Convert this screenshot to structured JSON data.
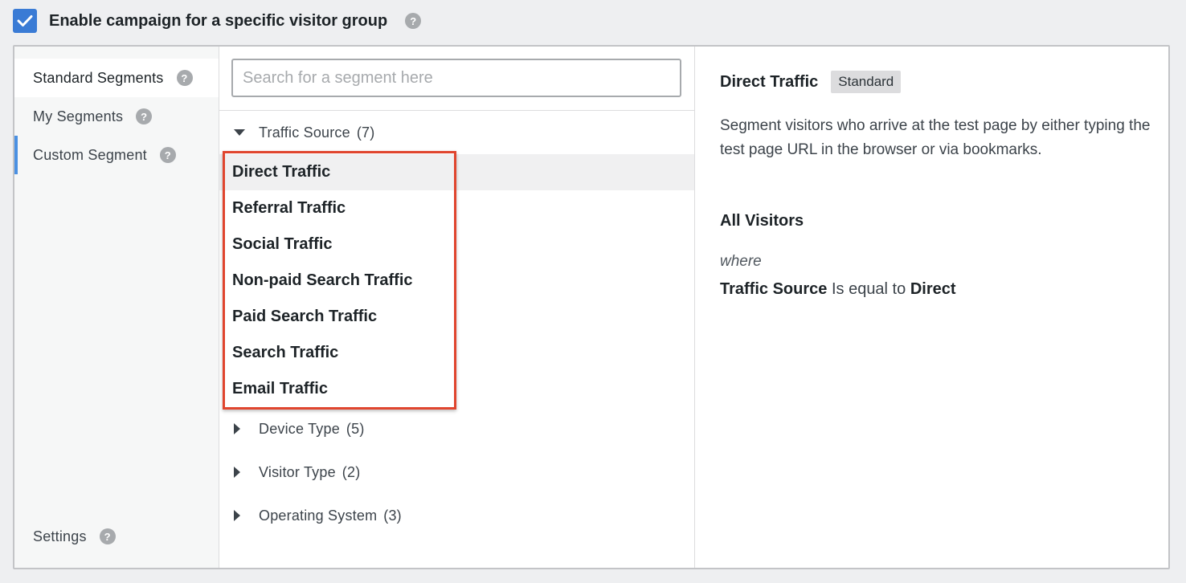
{
  "enable": {
    "label": "Enable campaign for a specific visitor group",
    "checked": true,
    "help_icon": "question-icon"
  },
  "sidebar": {
    "items": [
      {
        "label": "Standard Segments",
        "active": true
      },
      {
        "label": "My Segments",
        "active": false
      },
      {
        "label": "Custom Segment",
        "active": false
      }
    ],
    "settings_label": "Settings"
  },
  "search": {
    "placeholder": "Search for a segment here",
    "value": ""
  },
  "groups": [
    {
      "name": "Traffic Source",
      "count": "(7)",
      "expanded": true
    },
    {
      "name": "Device Type",
      "count": "(5)",
      "expanded": false
    },
    {
      "name": "Visitor Type",
      "count": "(2)",
      "expanded": false
    },
    {
      "name": "Operating System",
      "count": "(3)",
      "expanded": false
    }
  ],
  "segments": [
    "Direct Traffic",
    "Referral Traffic",
    "Social Traffic",
    "Non-paid Search Traffic",
    "Paid Search Traffic",
    "Search Traffic",
    "Email Traffic"
  ],
  "selected_segment": "Direct Traffic",
  "detail": {
    "title": "Direct Traffic",
    "badge": "Standard",
    "description": "Segment visitors who arrive at the test page by either typing the test page URL in the browser or via bookmarks.",
    "audience": "All Visitors",
    "where": "where",
    "rule": {
      "field": "Traffic Source",
      "operator": "Is equal to",
      "value": "Direct"
    }
  },
  "colors": {
    "accent": "#3a7bd5",
    "highlight_border": "#e0452e",
    "active_indicator": "#4a90e2"
  }
}
